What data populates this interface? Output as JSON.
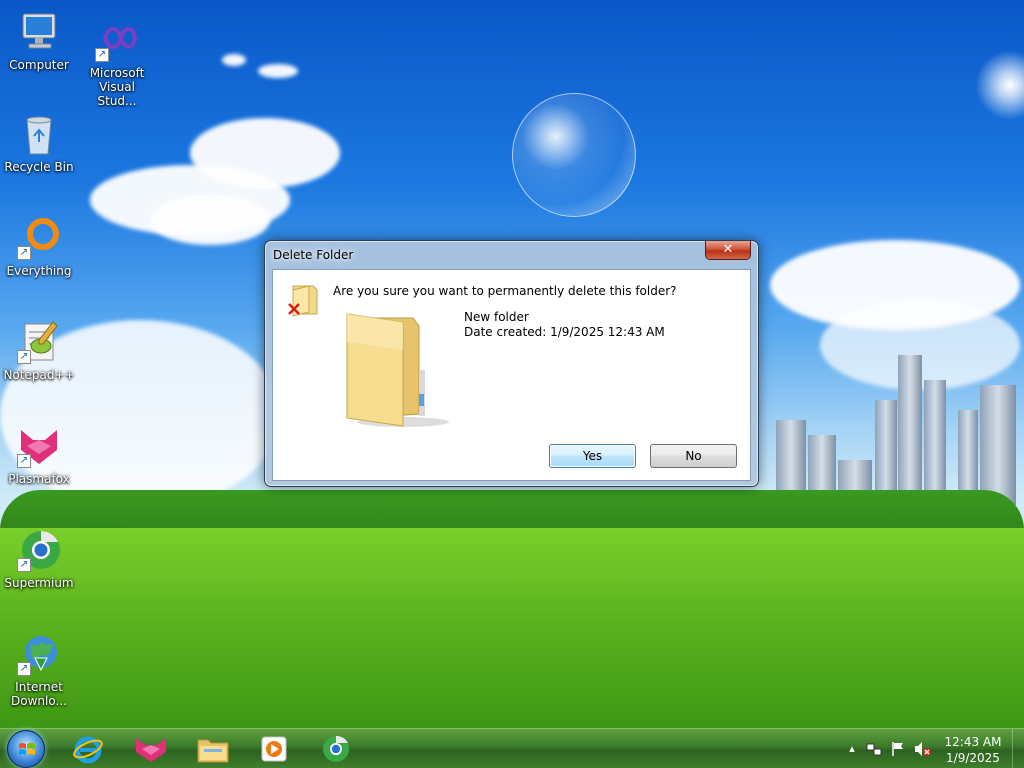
{
  "desktop": {
    "icons": [
      {
        "label": "Computer",
        "shortcut": false
      },
      {
        "label": "Microsoft Visual Stud...",
        "shortcut": true
      },
      {
        "label": "Recycle Bin",
        "shortcut": false
      },
      {
        "label": "Everything",
        "shortcut": true
      },
      {
        "label": "Notepad++",
        "shortcut": true
      },
      {
        "label": "Plasmafox",
        "shortcut": true
      },
      {
        "label": "Supermium",
        "shortcut": true
      },
      {
        "label": "Internet Downlo...",
        "shortcut": true
      }
    ]
  },
  "dialog": {
    "title": "Delete Folder",
    "close_label": "✕",
    "question": "Are you sure you want to permanently delete this folder?",
    "item_name": "New folder",
    "date_created": "Date created: 1/9/2025 12:43 AM",
    "yes_label": "Yes",
    "no_label": "No"
  },
  "taskbar": {
    "apps": [
      "internet-explorer",
      "plasmafox",
      "file-explorer",
      "media-player",
      "supermium"
    ],
    "tray_arrow": "▴",
    "clock_time": "12:43 AM",
    "clock_date": "1/9/2025"
  },
  "colors": {
    "accent": "#3c7fb1",
    "taskbar": "#3b7a2a",
    "close": "#c7402a"
  }
}
